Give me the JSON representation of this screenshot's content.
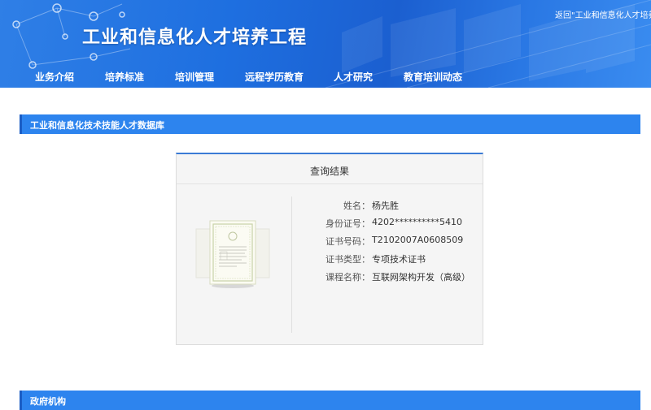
{
  "header": {
    "site_title": "工业和信息化人才培养工程",
    "top_link": "返回\"工业和信息化人才培养工程\""
  },
  "nav": {
    "items": [
      {
        "label": "业务介绍"
      },
      {
        "label": "培养标准"
      },
      {
        "label": "培训管理"
      },
      {
        "label": "远程学历教育"
      },
      {
        "label": "人才研究"
      },
      {
        "label": "教育培训动态"
      }
    ]
  },
  "database_section": {
    "title": "工业和信息化技术技能人才数据库"
  },
  "result": {
    "title": "查询结果",
    "fields": [
      {
        "label": "姓名：",
        "value": "杨先胜"
      },
      {
        "label": "身份证号：",
        "value": "4202**********5410"
      },
      {
        "label": "证书号码：",
        "value": "T2102007A0608509"
      },
      {
        "label": "证书类型：",
        "value": "专项技术证书"
      },
      {
        "label": "课程名称：",
        "value": "互联网架构开发（高级）"
      }
    ]
  },
  "gov_section": {
    "title": "政府机构"
  }
}
